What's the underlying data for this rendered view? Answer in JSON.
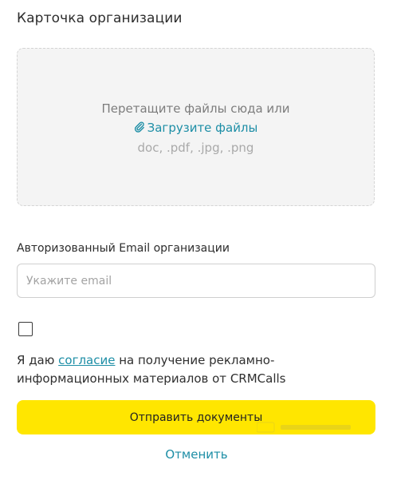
{
  "form": {
    "title": "Карточка организации",
    "dropzone": {
      "hint": "Перетащите файлы сюда или",
      "upload_label": "Загрузите файлы",
      "formats": "doc, .pdf, .jpg, .png"
    },
    "email": {
      "label": "Авторизованный Email организации",
      "value": "",
      "placeholder": "Укажите email"
    },
    "consent": {
      "checked": false,
      "prefix": "Я даю ",
      "link_label": "согласие",
      "suffix": " на получение рекламно-информационных материалов от CRMCalls"
    },
    "submit_label": "Отправить документы",
    "cancel_label": "Отменить"
  },
  "colors": {
    "accent": "#ffe600",
    "link": "#1d8ea6",
    "dropzone_bg": "#f4f4f4"
  },
  "icons": {
    "upload": "paperclip-icon"
  }
}
